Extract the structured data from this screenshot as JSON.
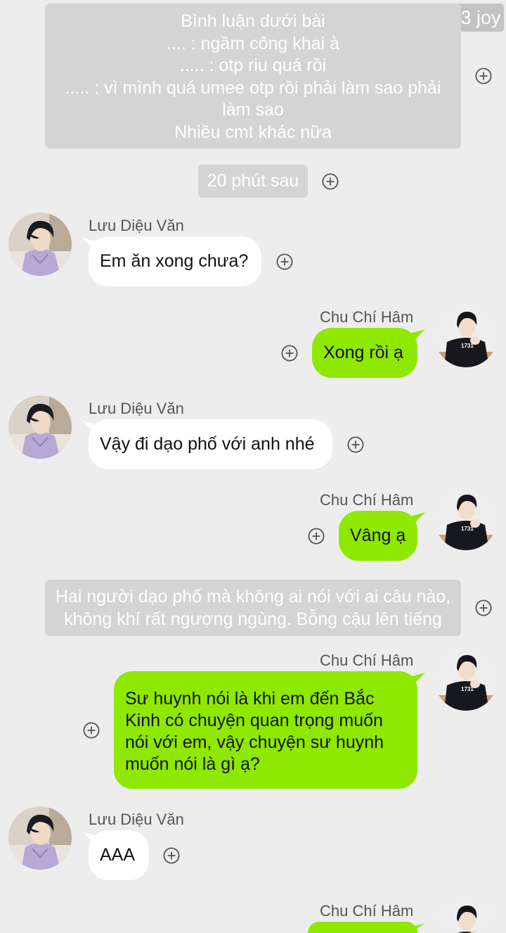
{
  "watermark": "183 joy",
  "narration_top": {
    "lines": [
      "Bình luận dưới bài",
      ".... : ngầm công khai à",
      "..... : otp riu quá rồi",
      "..... : vì mình quá umee otp rồi phải làm sao phải",
      "làm sao",
      "Nhiều cmt khác nữa"
    ]
  },
  "time_note": "20 phút sau",
  "narration_mid": {
    "lines": [
      "Hai người dạo phố mà không ai nói với ai câu nào,",
      "không khí rất ngượng ngùng. Bỗng cậu lên tiếng"
    ]
  },
  "messages": [
    {
      "sender": "Lưu Diệu Văn",
      "text": "Em ăn xong chưa?"
    },
    {
      "sender": "Chu Chí Hâm",
      "text": "Xong rồi ạ"
    },
    {
      "sender": "Lưu Diệu Văn",
      "text": "Vậy đi dạo phố với anh nhé"
    },
    {
      "sender": "Chu Chí Hâm",
      "text": "Vâng ạ"
    },
    {
      "sender": "Chu Chí Hâm",
      "lines": [
        "Sư huynh nói là khi em đến Bắc",
        "Kinh có chuyện quan trọng muốn",
        "nói với em, vậy chuyện sư huynh",
        "muốn nói là gì ạ?"
      ]
    },
    {
      "sender": "Lưu Diệu Văn",
      "text": "AAA"
    },
    {
      "sender": "Chu Chí Hâm",
      "text": ""
    }
  ],
  "colors": {
    "background": "#ededed",
    "system_box": "#d4d4d4",
    "green_bubble": "#8ee800",
    "white_bubble": "#ffffff"
  },
  "icons": {
    "add": "plus-circle-icon",
    "avatar_left": "avatar-luu-dieu-van",
    "avatar_right": "avatar-chu-chi-ham"
  }
}
